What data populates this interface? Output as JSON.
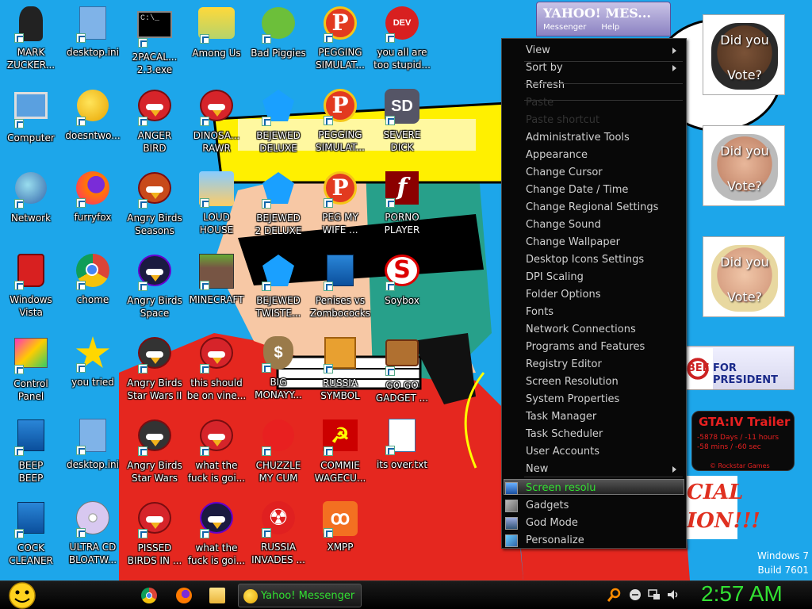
{
  "desktop_icons": [
    {
      "label": "MARK\nZUCKER...",
      "icon": "person-icon"
    },
    {
      "label": "desktop.ini",
      "icon": "ini-file-icon"
    },
    {
      "label": "2PACAL...\n2.3.exe",
      "icon": "console-icon"
    },
    {
      "label": "Among Us",
      "icon": "among-us-icon"
    },
    {
      "label": "Bad Piggies",
      "icon": "pig-icon"
    },
    {
      "label": "PEGGING\nSIMULAT...",
      "icon": "peggle-icon"
    },
    {
      "label": "you all are\ntoo stupid...",
      "icon": "devcpp-icon"
    },
    {
      "label": "Computer",
      "icon": "computer-icon"
    },
    {
      "label": "doesntwo...",
      "icon": "yahoo-icon"
    },
    {
      "label": "ANGER\nBIRD",
      "icon": "angry-bird-icon"
    },
    {
      "label": "DINOSA...\nRAWR",
      "icon": "angry-bird-icon"
    },
    {
      "label": "BEJEWED\nDELUXE",
      "icon": "gem-icon"
    },
    {
      "label": "PEGGING\nSIMULAT...",
      "icon": "peggle-icon"
    },
    {
      "label": "SEVERE\nDICK",
      "icon": "sd-icon"
    },
    {
      "label": "Network",
      "icon": "network-icon"
    },
    {
      "label": "furryfox",
      "icon": "firefox-icon"
    },
    {
      "label": "Angry Birds\nSeasons",
      "icon": "angry-birds-seasons-icon"
    },
    {
      "label": "LOUD\nHOUSE",
      "icon": "loud-house-icon"
    },
    {
      "label": "BEJEWED\n2 DELUXE",
      "icon": "gem-icon"
    },
    {
      "label": "PEG MY\nWIFE ...",
      "icon": "peggle-icon"
    },
    {
      "label": "PORNO\nPLAYER",
      "icon": "flash-icon"
    },
    {
      "label": "Windows\nVista",
      "icon": "recycle-bin-icon"
    },
    {
      "label": "chome",
      "icon": "chrome-icon"
    },
    {
      "label": "Angry Birds\nSpace",
      "icon": "angry-birds-space-icon"
    },
    {
      "label": "MINECRAFT",
      "icon": "minecraft-icon"
    },
    {
      "label": "BEJEWED\nTWISTE...",
      "icon": "gem-icon"
    },
    {
      "label": "Penises vs\nZombococks",
      "icon": "blue-folder-icon"
    },
    {
      "label": "Soybox",
      "icon": "soybox-icon"
    },
    {
      "label": "Control\nPanel",
      "icon": "control-panel-icon"
    },
    {
      "label": "you tried",
      "icon": "star-icon"
    },
    {
      "label": "Angry Birds\nStar Wars II",
      "icon": "angry-birds-star-wars-icon"
    },
    {
      "label": "this should\nbe on vine...",
      "icon": "angry-bird-icon"
    },
    {
      "label": "BIG\nMONAYY...",
      "icon": "money-bag-icon"
    },
    {
      "label": "RUSSIA\nSYMBOL",
      "icon": "blocks-icon"
    },
    {
      "label": "GO GO\nGADGET ...",
      "icon": "briefcase-icon"
    },
    {
      "label": "BEEP\nBEEP",
      "icon": "blue-folder-icon"
    },
    {
      "label": "desktop.ini",
      "icon": "ini-file-icon"
    },
    {
      "label": "Angry Birds\nStar Wars",
      "icon": "angry-birds-star-wars-icon"
    },
    {
      "label": "what the\nfuck is goi...",
      "icon": "angry-bird-icon"
    },
    {
      "label": "CHUZZLE\nMY CUM",
      "icon": "chuzzle-icon"
    },
    {
      "label": "COMMIE\nWAGECU...",
      "icon": "hammer-sickle-icon"
    },
    {
      "label": "its over.txt",
      "icon": "text-file-icon"
    },
    {
      "label": "COCK\nCLEANER",
      "icon": "blue-folder-icon"
    },
    {
      "label": "ULTRA CD\nBLOATW...",
      "icon": "cd-icon"
    },
    {
      "label": "PISSED\nBIRDS IN ...",
      "icon": "angry-bird-icon"
    },
    {
      "label": "what the\nfuck is goi...",
      "icon": "angry-birds-space-icon"
    },
    {
      "label": "RUSSIA\nINVADES ...",
      "icon": "radiation-icon"
    },
    {
      "label": "XMPP",
      "icon": "xampp-icon"
    }
  ],
  "yahoo_window": {
    "title": "YAHOO! MES...",
    "menu": [
      "Messenger",
      "Help"
    ]
  },
  "context_menu": {
    "items": [
      {
        "label": "View",
        "submenu": true,
        "disabled": false
      },
      {
        "label": "Sort by",
        "submenu": true,
        "disabled": false
      },
      {
        "label": "Refresh",
        "submenu": false,
        "disabled": false
      },
      {
        "label": "Paste",
        "submenu": false,
        "disabled": true
      },
      {
        "label": "Paste shortcut",
        "submenu": false,
        "disabled": true
      },
      {
        "label": "Administrative Tools",
        "submenu": false,
        "disabled": false
      },
      {
        "label": "Appearance",
        "submenu": false,
        "disabled": false
      },
      {
        "label": "Change Cursor",
        "submenu": false,
        "disabled": false
      },
      {
        "label": "Change Date / Time",
        "submenu": false,
        "disabled": false
      },
      {
        "label": "Change Regional Settings",
        "submenu": false,
        "disabled": false
      },
      {
        "label": "Change Sound",
        "submenu": false,
        "disabled": false
      },
      {
        "label": "Change Wallpaper",
        "submenu": false,
        "disabled": false
      },
      {
        "label": "Desktop Icons Settings",
        "submenu": false,
        "disabled": false
      },
      {
        "label": "DPI Scaling",
        "submenu": false,
        "disabled": false
      },
      {
        "label": "Folder Options",
        "submenu": false,
        "disabled": false
      },
      {
        "label": "Fonts",
        "submenu": false,
        "disabled": false
      },
      {
        "label": "Network Connections",
        "submenu": false,
        "disabled": false
      },
      {
        "label": "Programs and Features",
        "submenu": false,
        "disabled": false
      },
      {
        "label": "Registry Editor",
        "submenu": false,
        "disabled": false
      },
      {
        "label": "Screen Resolution",
        "submenu": false,
        "disabled": false
      },
      {
        "label": "System Properties",
        "submenu": false,
        "disabled": false
      },
      {
        "label": "Task Manager",
        "submenu": false,
        "disabled": false
      },
      {
        "label": "Task Scheduler",
        "submenu": false,
        "disabled": false
      },
      {
        "label": "User Accounts",
        "submenu": false,
        "disabled": false
      },
      {
        "label": "New",
        "submenu": true,
        "disabled": false
      }
    ],
    "bottom_items": [
      {
        "label": "Screen resolu",
        "icon": "monitor-icon",
        "highlighted": true
      },
      {
        "label": "Gadgets",
        "icon": "gadgets-icon",
        "highlighted": false
      },
      {
        "label": "God Mode",
        "icon": "god-mode-icon",
        "highlighted": false
      },
      {
        "label": "Personalize",
        "icon": "personalize-icon",
        "highlighted": false
      }
    ],
    "highlight_color": "#32e032"
  },
  "vote_cards": [
    {
      "line1": "Did you",
      "line2": "Vote?"
    },
    {
      "line1": "Did you",
      "line2": "Vote?"
    },
    {
      "line1": "Did you",
      "line2": "Vote?"
    }
  ],
  "huckabee": {
    "prefix": "BEE",
    "text": "FOR PRESIDENT"
  },
  "gta_gadget": {
    "title": "GTA:IV Trailer",
    "line1": "-5878 Days / -11 hours",
    "line2": "-58 mins / -60 sec",
    "footer": "© Rockstar Games"
  },
  "wallpaper_text": [
    "CIAL",
    "ION!!!"
  ],
  "windows_version": {
    "line1": "Windows 7",
    "line2": "Build 7601"
  },
  "taskbar": {
    "active_task": "Yahoo! Messenger",
    "clock": "2:57 AM",
    "clock_color": "#32e032"
  }
}
